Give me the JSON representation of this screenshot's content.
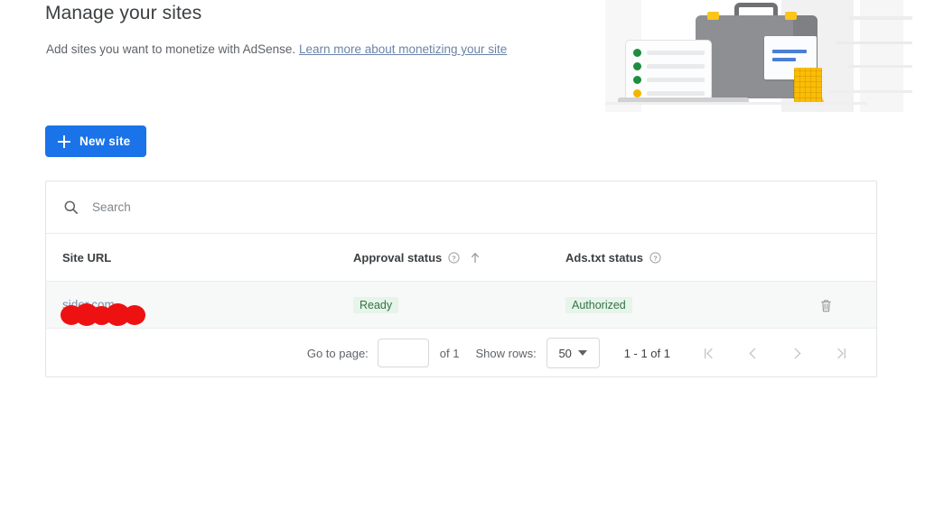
{
  "header": {
    "title": "Manage your sites",
    "subtitle_text": "Add sites you want to monetize with AdSense.",
    "subtitle_link": "Learn more about monetizing your site"
  },
  "actions": {
    "new_site_label": "New site",
    "new_site_icon": "plus-icon",
    "new_site_color": "#1a73e8"
  },
  "search": {
    "placeholder": "Search",
    "icon": "search-icon"
  },
  "table": {
    "columns": [
      {
        "label": "Site URL",
        "has_help": false,
        "sorted": false
      },
      {
        "label": "Approval status",
        "has_help": true,
        "help_icon": "help-circle-icon",
        "sorted": true,
        "sort_icon": "arrow-up-icon"
      },
      {
        "label": "Ads.txt status",
        "has_help": true,
        "help_icon": "help-circle-icon",
        "sorted": false
      }
    ],
    "rows": [
      {
        "site_url": "sider.com",
        "site_url_redacted": true,
        "approval_status": "Ready",
        "ads_txt_status": "Authorized",
        "delete_icon": "trash-icon"
      }
    ],
    "badge_bg": "#e7f4e9",
    "badge_fg": "#34734a"
  },
  "pagination": {
    "go_to_page_label": "Go to page:",
    "page_input_value": "",
    "of_text": "of 1",
    "show_rows_label": "Show rows:",
    "rows_value": "50",
    "rows_caret_icon": "chevron-down-icon",
    "range_text": "1 - 1 of 1",
    "first_icon": "first-page-icon",
    "prev_icon": "chevron-left-icon",
    "next_icon": "chevron-right-icon",
    "last_icon": "last-page-icon"
  }
}
